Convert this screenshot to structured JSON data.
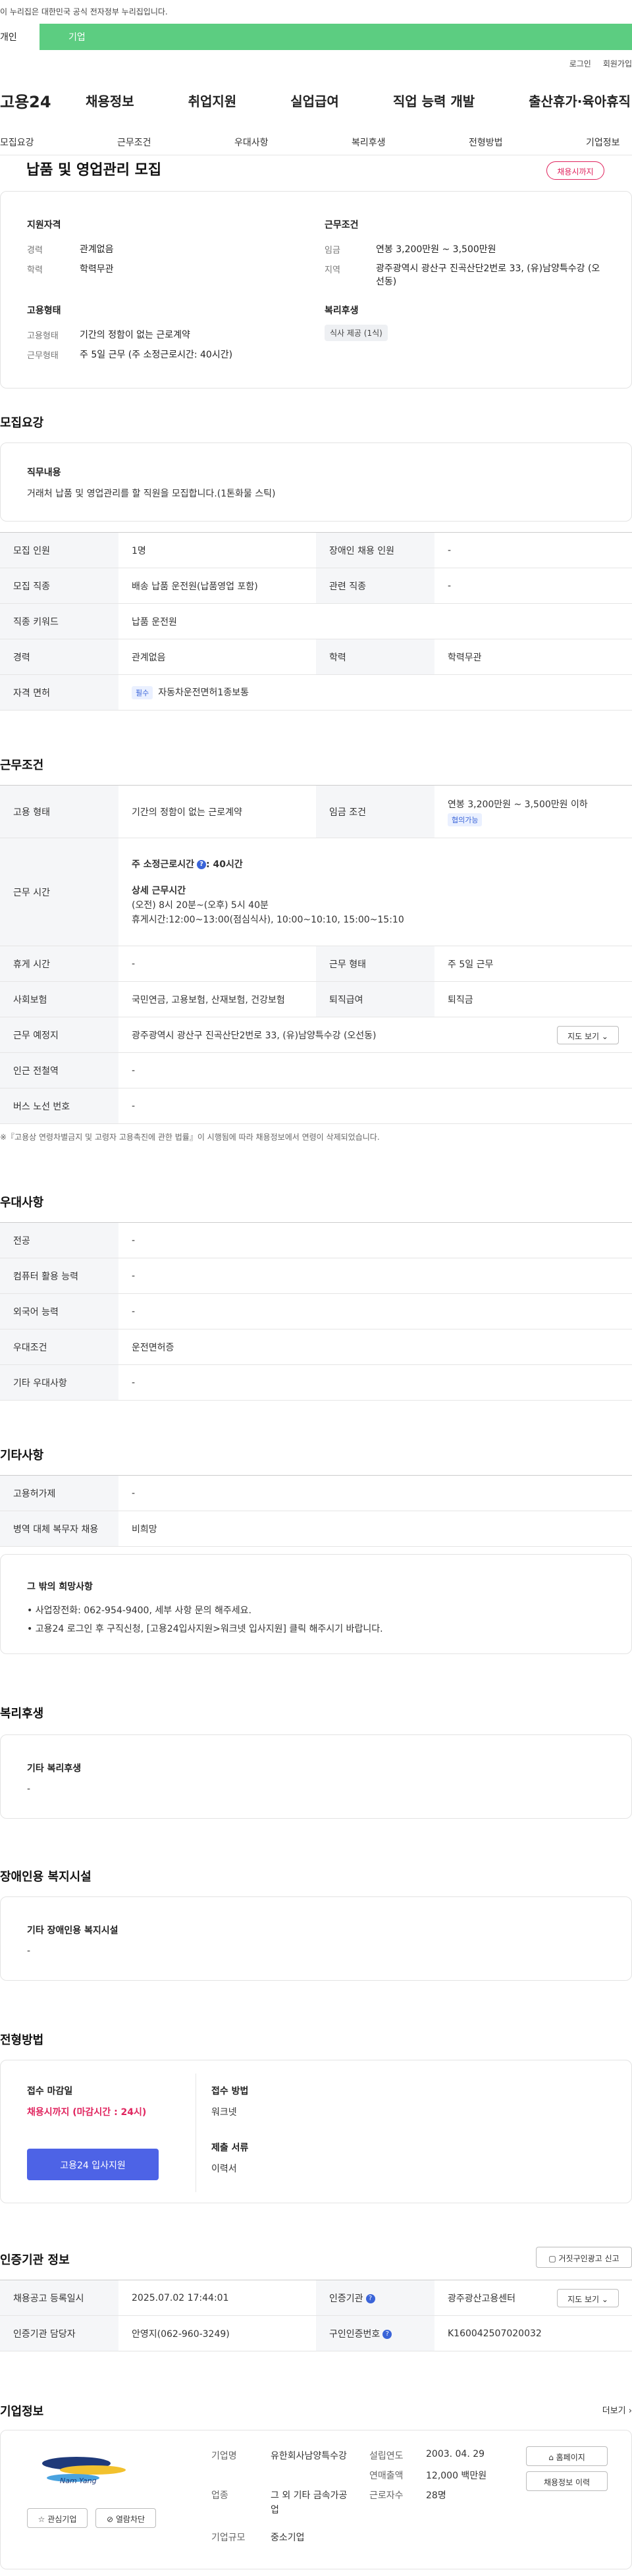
{
  "top_notice": "이 누리집은 대한민국 공식 전자정부 누리집입니다.",
  "user_tabs": {
    "person": "개인",
    "company": "기업"
  },
  "util_links": [
    "로그인",
    "회원가입"
  ],
  "gnb": {
    "logo": "고용24",
    "items": [
      "채용정보",
      "취업지원",
      "실업급여",
      "직업 능력 개발",
      "출산휴가·육아휴직"
    ]
  },
  "lnb": [
    "모집요강",
    "근무조건",
    "우대사항",
    "복리후생",
    "전형방법",
    "기업정보"
  ],
  "job": {
    "title": "납품 및 영업관리 모집",
    "status": "채용시까지"
  },
  "summary": {
    "qual_title": "지원자격",
    "qual": [
      {
        "k": "경력",
        "v": "관계없음"
      },
      {
        "k": "학력",
        "v": "학력무관"
      }
    ],
    "cond_title": "근무조건",
    "cond": [
      {
        "k": "임금",
        "v": "연봉 3,200만원 ~ 3,500만원"
      },
      {
        "k": "지역",
        "v": "광주광역시 광산구 진곡산단2번로 33, (유)남양특수강 (오선동)"
      }
    ],
    "type_title": "고용형태",
    "type": [
      {
        "k": "고용형태",
        "v": "기간의 정함이 없는 근로계약"
      },
      {
        "k": "근무형태",
        "v": "주 5일 근무 (주 소정근로시간: 40시간)"
      }
    ],
    "welfare_title": "복리후생",
    "welfare_badge": "식사 제공 (1식)"
  },
  "recruit": {
    "title": "모집요강",
    "duty_title": "직무내용",
    "duty_text": "거래처 납품 및 영업관리를 할 직원을 모집합니다.(1톤화물 스틱)",
    "rows": [
      {
        "k1": "모집 인원",
        "v1": "1명",
        "k2": "장애인 채용 인원",
        "v2": "-"
      },
      {
        "k1": "모집 직종",
        "v1": "배송 납품 운전원(납품영업 포함)",
        "k2": "관련 직종",
        "v2": "-"
      },
      {
        "k1": "직종 키워드",
        "v1": "납품 운전원"
      },
      {
        "k1": "경력",
        "v1": "관계없음",
        "k2": "학력",
        "v2": "학력무관"
      },
      {
        "k1": "자격 면허",
        "badge": "필수",
        "v1": "자동차운전면허1종보통"
      }
    ]
  },
  "work": {
    "title": "근무조건",
    "employ_k": "고용 형태",
    "employ_v": "기간의 정함이 없는 근로계약",
    "wage_k": "임금 조건",
    "wage_v": "연봉 3,200만원 ~ 3,500만원 이하",
    "wage_badge": "협의가능",
    "hours_k": "근무 시간",
    "hours_main": "주 소정근로시간",
    "hours_main_v": ": 40시간",
    "hours_detail_title": "상세 근무시간",
    "hours_detail": "(오전) 8시 20분~(오후) 5시 40분",
    "hours_break": "휴게시간:12:00~13:00(점심식사), 10:00~10:10, 15:00~15:10",
    "rest_k": "휴게 시간",
    "rest_v": "-",
    "shift_k": "근무 형태",
    "shift_v": "주 5일 근무",
    "ins_k": "사회보험",
    "ins_v": "국민연금, 고용보험, 산재보험, 건강보험",
    "sev_k": "퇴직급여",
    "sev_v": "퇴직금",
    "loc_k": "근무 예정지",
    "loc_v": "광주광역시 광산구 진곡산단2번로 33, (유)남양특수강 (오선동)",
    "map_btn": "지도 보기",
    "subway_k": "인근 전철역",
    "subway_v": "-",
    "bus_k": "버스 노선 번호",
    "bus_v": "-",
    "footnote": "※『고용상 연령차별금지 및 고령자 고용촉진에 관한 법률』이 시행됨에 따라 채용정보에서 연령이 삭제되었습니다."
  },
  "pref": {
    "title": "우대사항",
    "rows": [
      {
        "k": "전공",
        "v": "-"
      },
      {
        "k": "컴퓨터 활용 능력",
        "v": "-"
      },
      {
        "k": "외국어 능력",
        "v": "-"
      },
      {
        "k": "우대조건",
        "v": "운전면허증"
      },
      {
        "k": "기타 우대사항",
        "v": "-"
      }
    ]
  },
  "etc": {
    "title": "기타사항",
    "rows": [
      {
        "k": "고용허가제",
        "v": "-"
      },
      {
        "k": "병역 대체 복무자 채용",
        "v": "비희망"
      }
    ],
    "box_title": "그 밖의 희망사항",
    "box_lines": [
      "• 사업장전화: 062-954-9400, 세부 사항 문의 해주세요.",
      "• 고용24 로그인 후 구직신청, [고용24입사지원>워크넷 입사지원] 클릭 해주시기 바랍니다."
    ]
  },
  "welfare": {
    "title": "복리후생",
    "box_title": "기타 복리후생",
    "box_v": "-"
  },
  "disab": {
    "title": "장애인용 복지시설",
    "box_title": "기타 장애인용 복지시설",
    "box_v": "-"
  },
  "process": {
    "title": "전형방법",
    "deadline_title": "접수 마감일",
    "deadline_v": "채용시까지 (마감시간 : 24시)",
    "apply_btn": "고용24 입사지원",
    "method_title": "접수 방법",
    "method_v": "워크넷",
    "docs_title": "제출 서류",
    "docs_v": "이력서"
  },
  "cert": {
    "title": "인증기관 정보",
    "report_btn": "거짓구인광고 신고",
    "reg_k": "채용공고 등록일시",
    "reg_v": "2025.07.02 17:44:01",
    "org_k": "인증기관",
    "org_v": "광주광산고용센터",
    "map_btn": "지도 보기",
    "mgr_k": "인증기관 담당자",
    "mgr_v": "안영지(062-960-3249)",
    "num_k": "구인인증번호",
    "num_v": "K160042507020032"
  },
  "company": {
    "title": "기업정보",
    "more": "더보기",
    "logo_text": "Nam Yang",
    "interest_btn": "관심기업",
    "block_btn": "열람차단",
    "name_k": "기업명",
    "name_v": "유한회사남양특수강",
    "ind_k": "업종",
    "ind_v": "그 외 기타 금속가공업",
    "size_k": "기업규모",
    "size_v": "중소기업",
    "year_k": "설립연도",
    "year_v": "2003. 04. 29",
    "sales_k": "연매출액",
    "sales_v": "12,000 백만원",
    "emp_k": "근로자수",
    "emp_v": "28명",
    "home_btn": "홈페이지",
    "hist_btn": "채용정보 이력"
  },
  "colors": {
    "green": "#5ccd81",
    "pink": "#e0245e",
    "blue": "#4d63e6"
  }
}
